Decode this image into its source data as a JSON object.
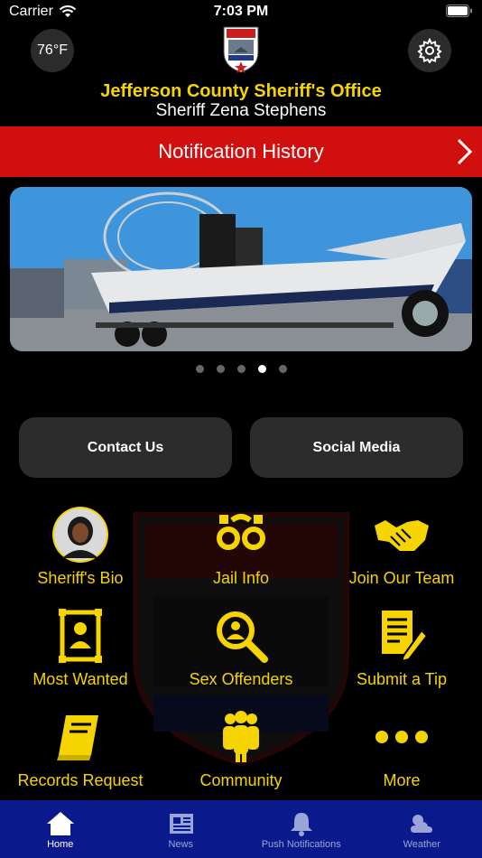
{
  "status_bar": {
    "carrier": "Carrier",
    "time": "7:03 PM"
  },
  "header": {
    "temperature": "76°F",
    "title": "Jefferson County Sheriff's Office",
    "subtitle": "Sheriff Zena Stephens"
  },
  "notification_bar": {
    "label": "Notification History"
  },
  "carousel": {
    "active_index": 3,
    "total": 5
  },
  "quick_buttons": {
    "contact_label": "Contact Us",
    "social_label": "Social Media"
  },
  "grid": [
    {
      "label": "Sheriff's Bio",
      "icon": "sheriff-portrait"
    },
    {
      "label": "Jail Info",
      "icon": "handcuffs-icon"
    },
    {
      "label": "Join Our Team",
      "icon": "handshake-icon"
    },
    {
      "label": "Most Wanted",
      "icon": "wanted-poster-icon"
    },
    {
      "label": "Sex Offenders",
      "icon": "magnify-person-icon"
    },
    {
      "label": "Submit a Tip",
      "icon": "document-pen-icon"
    },
    {
      "label": "Records Request",
      "icon": "book-icon"
    },
    {
      "label": "Community",
      "icon": "group-icon"
    },
    {
      "label": "More",
      "icon": "ellipsis-icon"
    }
  ],
  "tab_bar": {
    "items": [
      {
        "label": "Home",
        "icon": "home-icon",
        "active": true
      },
      {
        "label": "News",
        "icon": "newspaper-icon",
        "active": false
      },
      {
        "label": "Push Notifications",
        "icon": "bell-icon",
        "active": false
      },
      {
        "label": "Weather",
        "icon": "weather-icon",
        "active": false
      }
    ]
  },
  "colors": {
    "accent_yellow": "#f5d400",
    "notification_red": "#d10f0f",
    "tab_bar_blue": "#0a1a8c"
  }
}
